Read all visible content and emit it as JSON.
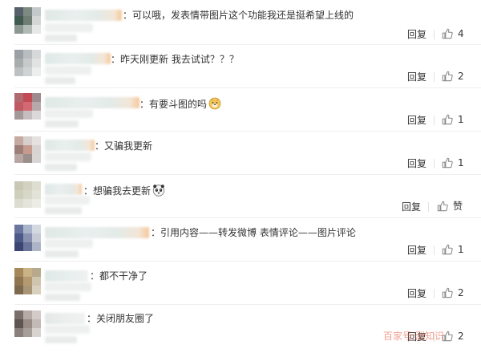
{
  "comments": [
    {
      "text": "：可以哦，发表情带图片这个功能我还是挺希望上线的",
      "reply": "回复",
      "likes": "4"
    },
    {
      "text": "：昨天刚更新 我去试试？？？",
      "reply": "回复",
      "likes": "2"
    },
    {
      "text": "：有要斗图的吗",
      "reply": "回复",
      "likes": "1",
      "emoji": "doge-emoji"
    },
    {
      "text": "：又骗我更新",
      "reply": "回复",
      "likes": "1"
    },
    {
      "text": "：想骗我去更新",
      "reply": "回复",
      "likes": "赞",
      "emoji": "panda-emoji"
    },
    {
      "text": "：引用内容——转发微博   表情评论——图片评论",
      "reply": "回复",
      "likes": "1"
    },
    {
      "text": "：都不干净了",
      "reply": "回复",
      "likes": "2"
    },
    {
      "text": "：关闭朋友圈了",
      "reply": "回复",
      "likes": "2"
    }
  ],
  "watermark": "百家号/涨知识",
  "icons": {
    "like": "thumbs-up-icon"
  },
  "colors": {
    "text": "#333333",
    "divider": "#efefef",
    "icon": "#888888"
  }
}
